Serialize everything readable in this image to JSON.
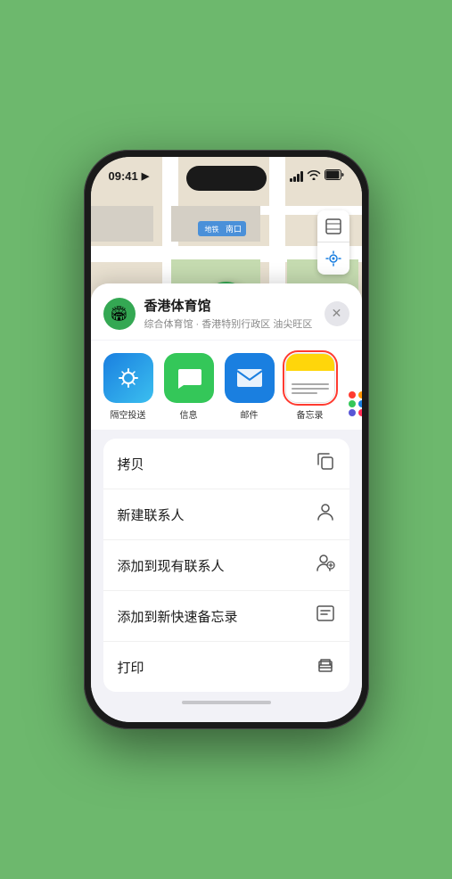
{
  "statusBar": {
    "time": "09:41",
    "locationIcon": "▶"
  },
  "mapLabel": {
    "text": "南口"
  },
  "mapBtns": {
    "layerIcon": "🗺",
    "locationIcon": "➤"
  },
  "locationPin": {
    "label": "香港体育馆",
    "icon": "🏟"
  },
  "sheet": {
    "venueName": "香港体育馆",
    "venueSub": "综合体育馆 · 香港特别行政区 油尖旺区",
    "closeLabel": "✕"
  },
  "shareApps": [
    {
      "id": "airdrop",
      "label": "隔空投送",
      "type": "airdrop"
    },
    {
      "id": "message",
      "label": "信息",
      "type": "message"
    },
    {
      "id": "mail",
      "label": "邮件",
      "type": "mail"
    },
    {
      "id": "notes",
      "label": "备忘录",
      "type": "notes",
      "selected": true
    }
  ],
  "actions": [
    {
      "id": "copy",
      "label": "拷贝",
      "icon": "copy"
    },
    {
      "id": "new-contact",
      "label": "新建联系人",
      "icon": "person"
    },
    {
      "id": "add-contact",
      "label": "添加到现有联系人",
      "icon": "person-add"
    },
    {
      "id": "quick-note",
      "label": "添加到新快速备忘录",
      "icon": "note"
    },
    {
      "id": "print",
      "label": "打印",
      "icon": "printer"
    }
  ],
  "colors": {
    "green": "#34a853",
    "blue": "#1a7fe0",
    "red": "#ff3b30",
    "accent1": "#ff3b30",
    "accent2": "#ff9500",
    "accent3": "#34c759",
    "moreDotsColors": [
      "#ff3b30",
      "#ff9500",
      "#34c759",
      "#1a7fe0",
      "#5856d6",
      "#ff2d55"
    ]
  }
}
